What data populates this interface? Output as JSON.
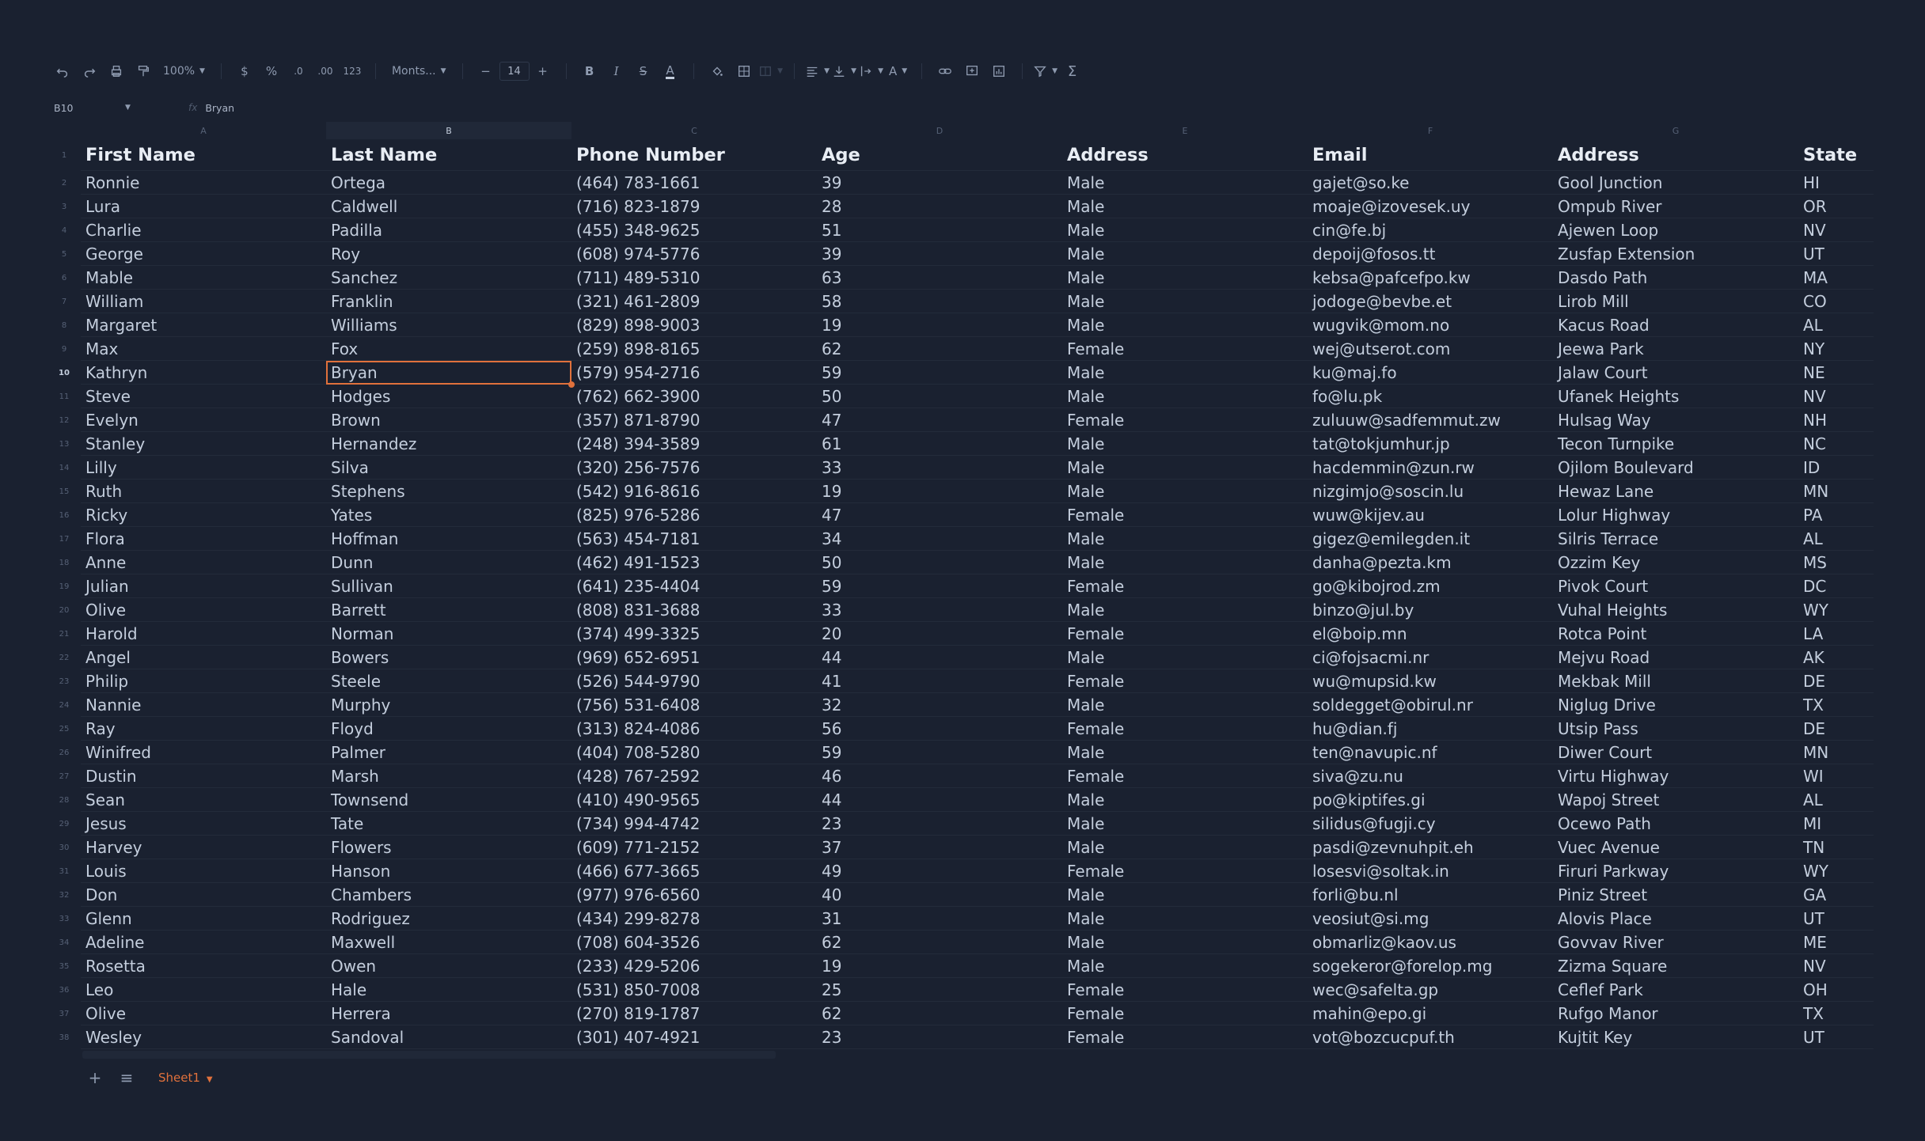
{
  "toolbar": {
    "zoom": "100%",
    "currency": "$",
    "percent": "%",
    "dec_less": ".0",
    "dec_more": ".00",
    "number_format": "123",
    "font": "Monts...",
    "font_size": "14",
    "minus": "−",
    "plus": "+"
  },
  "formula_bar": {
    "cell_ref": "B10",
    "fx": "fx",
    "value": "Bryan"
  },
  "columns": [
    "A",
    "B",
    "C",
    "D",
    "E",
    "F",
    "G"
  ],
  "selected_column": "B",
  "selected_row": 10,
  "headers": [
    "First Name",
    "Last Name",
    "Phone Number",
    "Age",
    "Address",
    "Email",
    "Address",
    "State"
  ],
  "rows": [
    [
      "Ronnie",
      "Ortega",
      "(464) 783-1661",
      "39",
      "Male",
      "gajet@so.ke",
      "Gool Junction",
      "HI"
    ],
    [
      "Lura",
      "Caldwell",
      "(716) 823-1879",
      "28",
      "Male",
      "moaje@izovesek.uy",
      "Ompub River",
      "OR"
    ],
    [
      "Charlie",
      "Padilla",
      "(455) 348-9625",
      "51",
      "Male",
      "cin@fe.bj",
      "Ajewen Loop",
      "NV"
    ],
    [
      "George",
      "Roy",
      "(608) 974-5776",
      "39",
      "Male",
      "depoij@fosos.tt",
      "Zusfap Extension",
      "UT"
    ],
    [
      "Mable",
      "Sanchez",
      "(711) 489-5310",
      "63",
      "Male",
      "kebsa@pafcefpo.kw",
      "Dasdo Path",
      "MA"
    ],
    [
      "William",
      "Franklin",
      "(321) 461-2809",
      "58",
      "Male",
      "jodoge@bevbe.et",
      "Lirob Mill",
      "CO"
    ],
    [
      "Margaret",
      "Williams",
      "(829) 898-9003",
      "19",
      "Male",
      "wugvik@mom.no",
      "Kacus Road",
      "AL"
    ],
    [
      "Max",
      "Fox",
      "(259) 898-8165",
      "62",
      "Female",
      "wej@utserot.com",
      "Jeewa Park",
      "NY"
    ],
    [
      "Kathryn",
      "Bryan",
      "(579) 954-2716",
      "59",
      "Male",
      "ku@maj.fo",
      "Jalaw Court",
      "NE"
    ],
    [
      "Steve",
      "Hodges",
      "(762) 662-3900",
      "50",
      "Male",
      "fo@lu.pk",
      "Ufanek Heights",
      "NV"
    ],
    [
      "Evelyn",
      "Brown",
      "(357) 871-8790",
      "47",
      "Female",
      "zuluuw@sadfemmut.zw",
      "Hulsag Way",
      "NH"
    ],
    [
      "Stanley",
      "Hernandez",
      "(248) 394-3589",
      "61",
      "Male",
      "tat@tokjumhur.jp",
      "Tecon Turnpike",
      "NC"
    ],
    [
      "Lilly",
      "Silva",
      "(320) 256-7576",
      "33",
      "Male",
      "hacdemmin@zun.rw",
      "Ojilom Boulevard",
      "ID"
    ],
    [
      "Ruth",
      "Stephens",
      "(542) 916-8616",
      "19",
      "Male",
      "nizgimjo@soscin.lu",
      "Hewaz Lane",
      "MN"
    ],
    [
      "Ricky",
      "Yates",
      "(825) 976-5286",
      "47",
      "Female",
      "wuw@kijev.au",
      "Lolur Highway",
      "PA"
    ],
    [
      "Flora",
      "Hoffman",
      "(563) 454-7181",
      "34",
      "Male",
      "gigez@emilegden.it",
      "Silris Terrace",
      "AL"
    ],
    [
      "Anne",
      "Dunn",
      "(462) 491-1523",
      "50",
      "Male",
      "danha@pezta.km",
      "Ozzim Key",
      "MS"
    ],
    [
      "Julian",
      "Sullivan",
      "(641) 235-4404",
      "59",
      "Female",
      "go@kibojrod.zm",
      "Pivok Court",
      "DC"
    ],
    [
      "Olive",
      "Barrett",
      "(808) 831-3688",
      "33",
      "Male",
      "binzo@jul.by",
      "Vuhal Heights",
      "WY"
    ],
    [
      "Harold",
      "Norman",
      "(374) 499-3325",
      "20",
      "Female",
      "el@boip.mn",
      "Rotca Point",
      "LA"
    ],
    [
      "Angel",
      "Bowers",
      "(969) 652-6951",
      "44",
      "Male",
      "ci@fojsacmi.nr",
      "Mejvu Road",
      "AK"
    ],
    [
      "Philip",
      "Steele",
      "(526) 544-9790",
      "41",
      "Female",
      "wu@mupsid.kw",
      "Mekbak Mill",
      "DE"
    ],
    [
      "Nannie",
      "Murphy",
      "(756) 531-6408",
      "32",
      "Male",
      "soldegget@obirul.nr",
      "Niglug Drive",
      "TX"
    ],
    [
      "Ray",
      "Floyd",
      "(313) 824-4086",
      "56",
      "Female",
      "hu@dian.fj",
      "Utsip Pass",
      "DE"
    ],
    [
      "Winifred",
      "Palmer",
      "(404) 708-5280",
      "59",
      "Male",
      "ten@navupic.nf",
      "Diwer Court",
      "MN"
    ],
    [
      "Dustin",
      "Marsh",
      "(428) 767-2592",
      "46",
      "Female",
      "siva@zu.nu",
      "Virtu Highway",
      "WI"
    ],
    [
      "Sean",
      "Townsend",
      "(410) 490-9565",
      "44",
      "Male",
      "po@kiptifes.gi",
      "Wapoj Street",
      "AL"
    ],
    [
      "Jesus",
      "Tate",
      "(734) 994-4742",
      "23",
      "Male",
      "silidus@fugji.cy",
      "Ocewo Path",
      "MI"
    ],
    [
      "Harvey",
      "Flowers",
      "(609) 771-2152",
      "37",
      "Male",
      "pasdi@zevnuhpit.eh",
      "Vuec Avenue",
      "TN"
    ],
    [
      "Louis",
      "Hanson",
      "(466) 677-3665",
      "49",
      "Female",
      "losesvi@soltak.in",
      "Firuri Parkway",
      "WY"
    ],
    [
      "Don",
      "Chambers",
      "(977) 976-6560",
      "40",
      "Male",
      "forli@bu.nl",
      "Piniz Street",
      "GA"
    ],
    [
      "Glenn",
      "Rodriguez",
      "(434) 299-8278",
      "31",
      "Male",
      "veosiut@si.mg",
      "Alovis Place",
      "UT"
    ],
    [
      "Adeline",
      "Maxwell",
      "(708) 604-3526",
      "62",
      "Male",
      "obmarliz@kaov.us",
      "Govvav River",
      "ME"
    ],
    [
      "Rosetta",
      "Owen",
      "(233) 429-5206",
      "19",
      "Male",
      "sogekeror@forelop.mg",
      "Zizma Square",
      "NV"
    ],
    [
      "Leo",
      "Hale",
      "(531) 850-7008",
      "25",
      "Female",
      "wec@safelta.gp",
      "Ceflef Park",
      "OH"
    ],
    [
      "Olive",
      "Herrera",
      "(270) 819-1787",
      "62",
      "Female",
      "mahin@epo.gi",
      "Rufgo Manor",
      "TX"
    ],
    [
      "Wesley",
      "Sandoval",
      "(301) 407-4921",
      "23",
      "Female",
      "vot@bozcucpuf.th",
      "Kujtit Key",
      "UT"
    ]
  ],
  "footer": {
    "add_sheet": "+",
    "sheet_list": "≡",
    "sheet_name": "Sheet1"
  },
  "colors": {
    "background": "#1a2130",
    "accent": "#e0713c",
    "text": "#c4cedd"
  }
}
